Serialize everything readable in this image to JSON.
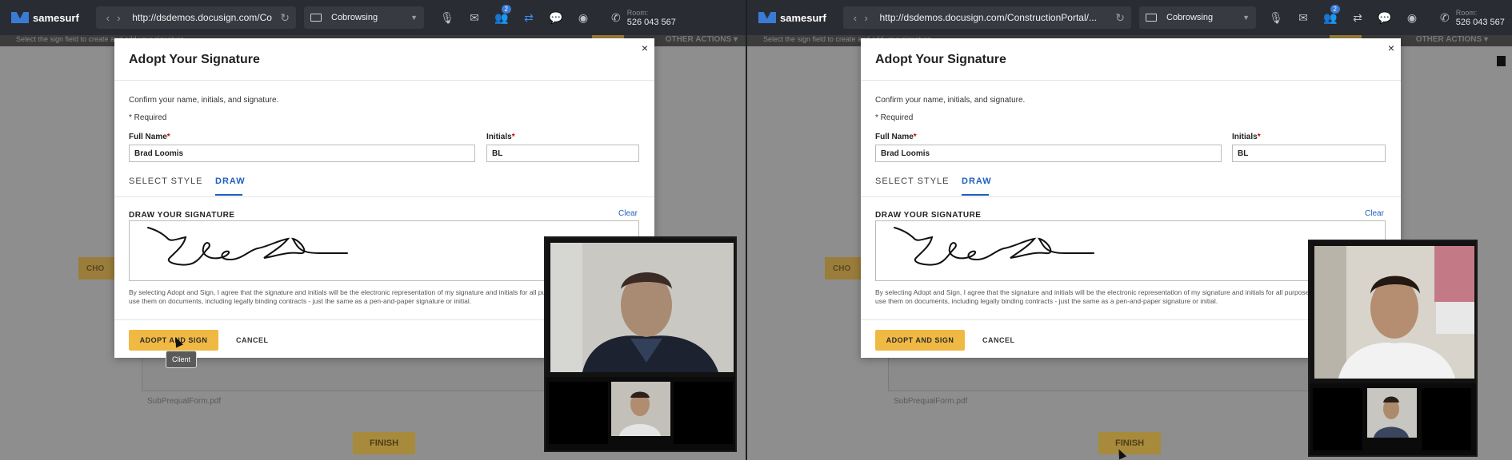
{
  "panes": [
    {
      "id": "left",
      "toolbar": {
        "brand": "samesurf",
        "url": "http://dsdemos.docusign.com/ConstructionP...",
        "mode": "Cobrowsing",
        "participants_badge": "2",
        "room_label": "Room:",
        "room_number": "526 043 567"
      },
      "background": {
        "hint": "Select the sign field to create and add your signature",
        "other_actions": "OTHER ACTIONS ▾",
        "choose_label": "CHO",
        "pdf_name": "SubPrequalForm.pdf",
        "finish_label": "FINISH"
      },
      "tooltip": "Client"
    },
    {
      "id": "right",
      "toolbar": {
        "brand": "samesurf",
        "url": "http://dsdemos.docusign.com/ConstructionPortal/...",
        "mode": "Cobrowsing",
        "participants_badge": "2",
        "room_label": "Room:",
        "room_number": "526 043 567"
      },
      "background": {
        "hint": "Select the sign field to create and add your signature",
        "other_actions": "OTHER ACTIONS ▾",
        "choose_label": "CHO",
        "pdf_name": "SubPrequalForm.pdf",
        "finish_label": "FINISH"
      }
    }
  ],
  "modal": {
    "title": "Adopt Your Signature",
    "close": "×",
    "confirm_text": "Confirm your name, initials, and signature.",
    "required_text": "* Required",
    "full_name_label": "Full Name",
    "full_name_value": "Brad Loomis",
    "initials_label": "Initials",
    "initials_value": "BL",
    "tab_style": "SELECT STYLE",
    "tab_draw": "DRAW",
    "draw_label": "DRAW YOUR SIGNATURE",
    "clear": "Clear",
    "legal_left": "By selecting Adopt and Sign, I agree that the signature and initials will be the electronic representation of my signature and initials for all purposes when I (or my agent) use them on documents, including legally binding contracts - just the same as a pen-and-paper signature or initial.",
    "legal_right": "By selecting Adopt and Sign, I agree that the signature and initials will be the electronic representation of my signature and initials for all purposes when I (or my agent) use them on documents, including legally binding contracts - just the same as a pen-and-paper signature or initial.",
    "adopt_button": "ADOPT AND SIGN",
    "cancel_button": "CANCEL"
  },
  "icons": {
    "back": "‹",
    "forward": "›",
    "reload": "↻",
    "mic": "🎙",
    "mail": "✉",
    "people": "👥",
    "swap": "⇄",
    "chat": "💬",
    "record": "◉",
    "phone": "✆",
    "move": "✥"
  }
}
